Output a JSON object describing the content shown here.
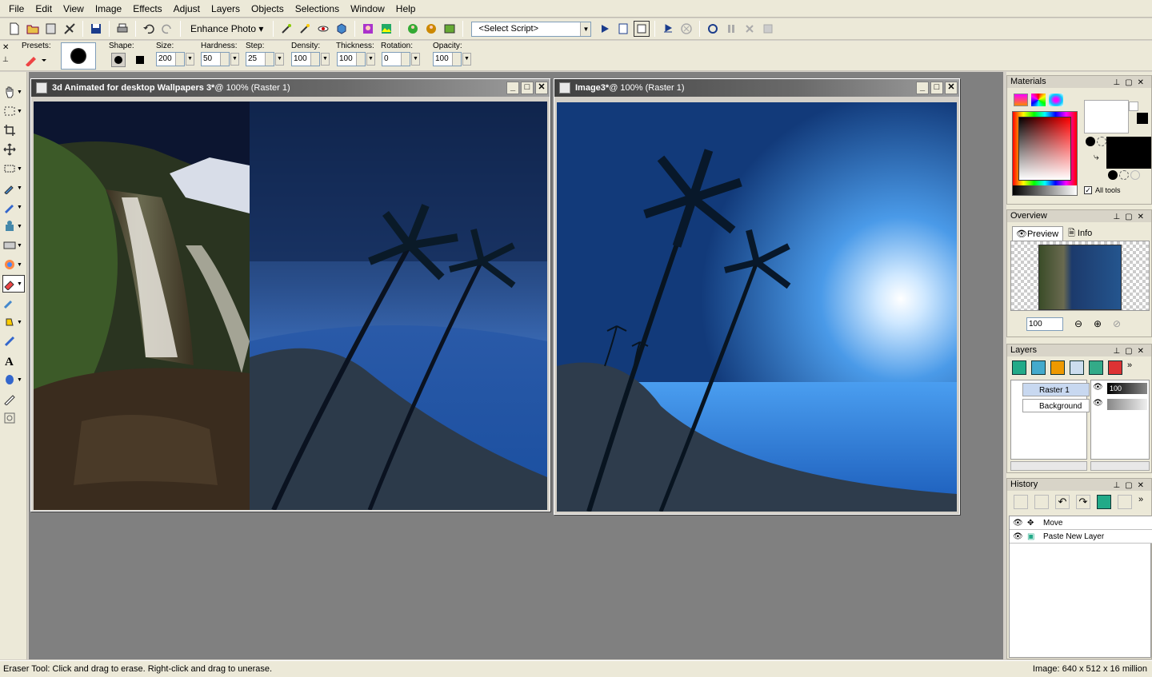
{
  "menu": [
    "File",
    "Edit",
    "View",
    "Image",
    "Effects",
    "Adjust",
    "Layers",
    "Objects",
    "Selections",
    "Window",
    "Help"
  ],
  "toolbar": {
    "enhance_label": "Enhance Photo",
    "script_placeholder": "<Select Script>"
  },
  "tool_options": {
    "presets_label": "Presets:",
    "shape_label": "Shape:",
    "size_label": "Size:",
    "size_value": "200",
    "hardness_label": "Hardness:",
    "hardness_value": "50",
    "step_label": "Step:",
    "step_value": "25",
    "density_label": "Density:",
    "density_value": "100",
    "thickness_label": "Thickness:",
    "thickness_value": "100",
    "rotation_label": "Rotation:",
    "rotation_value": "0",
    "opacity_label": "Opacity:",
    "opacity_value": "100"
  },
  "doc1": {
    "title": "3d Animated for desktop Wallpapers 3*",
    "suffix": " @ 100% (Raster 1)"
  },
  "doc2": {
    "title": "Image3*",
    "suffix": " @ 100% (Raster 1)"
  },
  "panels": {
    "materials": {
      "title": "Materials",
      "all_tools": "All tools"
    },
    "overview": {
      "title": "Overview",
      "tab_preview": "Preview",
      "tab_info": "Info",
      "zoom": "100"
    },
    "layers": {
      "title": "Layers",
      "items": [
        {
          "name": "Raster 1",
          "opacity": "100"
        },
        {
          "name": "Background"
        }
      ]
    },
    "history": {
      "title": "History",
      "items": [
        "Move",
        "Paste New Layer"
      ]
    }
  },
  "status": {
    "left": "Eraser Tool: Click and drag to erase. Right-click and drag to unerase.",
    "right": "Image:  640 x 512 x 16 million"
  },
  "colors": {
    "accent": "#0a246a",
    "workspace": "#808080"
  }
}
